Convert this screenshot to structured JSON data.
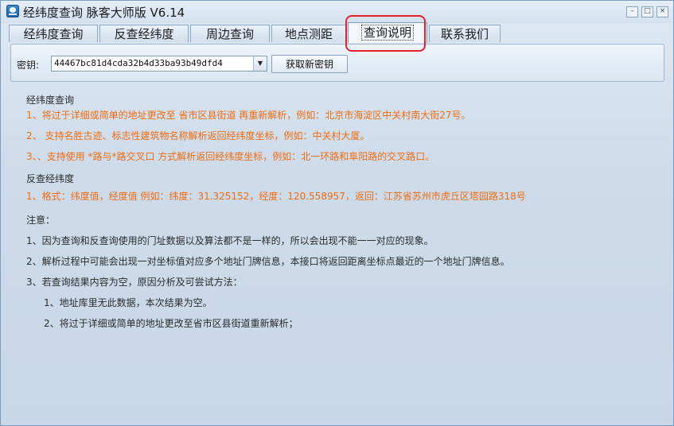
{
  "window": {
    "title": "经纬度查询  脉客大师版  V6.14",
    "controls": {
      "minimize": "–",
      "maximize": "□",
      "close": "×"
    }
  },
  "tabs": [
    {
      "label": "经纬度查询",
      "active": false
    },
    {
      "label": "反查经纬度",
      "active": false
    },
    {
      "label": "周边查询",
      "active": false
    },
    {
      "label": "地点测距",
      "active": false
    },
    {
      "label": "查询说明",
      "active": true
    },
    {
      "label": "联系我们",
      "active": false
    }
  ],
  "key_panel": {
    "label": "密钥:",
    "value": "44467bc81d4cda32b4d33ba93b49dfd4",
    "button": "获取新密钥"
  },
  "help": {
    "section1_title": "经纬度查询",
    "section1_items": [
      "1、将过于详细或简单的地址更改至 省市区县街道 再重新解析，例如：北京市海淀区中关村南大街27号。",
      "2、   支持名胜古迹、标志性建筑物名称解析返回经纬度坐标，例如：中关村大厦。",
      "3、、支持使用 *路与*路交叉口 方式解析返回经纬度坐标，例如：北一环路和阜阳路的交叉路口。"
    ],
    "section2_title": "反查经纬度",
    "section2_items": [
      "1、格式：纬度值，经度值 例如：纬度：31.325152，经度：120.558957，返回：江苏省苏州市虎丘区塔园路318号"
    ],
    "notes_title": "注意：",
    "notes": [
      "1、因为查询和反查询使用的门址数据以及算法都不是一样的，所以会出现不能一一对应的现象。",
      "2、解析过程中可能会出现一对坐标值对应多个地址门牌信息，本接口将返回距离坐标点最近的一个地址门牌信息。",
      "3、若查询结果内容为空，原因分析及可尝试方法："
    ],
    "sub_notes": [
      "1、地址库里无此数据，本次结果为空。",
      "2、将过于详细或简单的地址更改至省市区县街道重新解析；"
    ]
  },
  "colors": {
    "accent_text": "#f26c0f",
    "highlight": "#e2222b"
  }
}
